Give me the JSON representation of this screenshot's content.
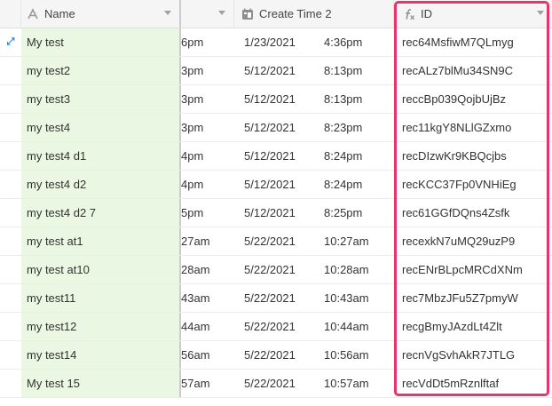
{
  "columns": {
    "name": "Name",
    "time": "Create Time 2",
    "id": "ID"
  },
  "colors": {
    "primary_col_bg": "#eaf8e3",
    "selection": "#e8336d",
    "expand_icon": "#2d7ff9"
  },
  "icons": {
    "name_field": "text-field-icon",
    "time_field": "calendar-field-icon",
    "id_field": "formula-field-icon",
    "row_expand": "expand-arrows-icon"
  },
  "rows": [
    {
      "name": "My test",
      "hidden": "6pm",
      "date": "1/23/2021",
      "time": "4:36pm",
      "id": "rec64MsfiwM7QLmyg"
    },
    {
      "name": "my test2",
      "hidden": "3pm",
      "date": "5/12/2021",
      "time": "8:13pm",
      "id": "recALz7blMu34SN9C"
    },
    {
      "name": "my test3",
      "hidden": "3pm",
      "date": "5/12/2021",
      "time": "8:13pm",
      "id": "reccBp039QojbUjBz"
    },
    {
      "name": "my test4",
      "hidden": "3pm",
      "date": "5/12/2021",
      "time": "8:23pm",
      "id": "rec11kgY8NLlGZxmo"
    },
    {
      "name": "my test4 d1",
      "hidden": "4pm",
      "date": "5/12/2021",
      "time": "8:24pm",
      "id": "recDIzwKr9KBQcjbs"
    },
    {
      "name": "my test4 d2",
      "hidden": "4pm",
      "date": "5/12/2021",
      "time": "8:24pm",
      "id": "recKCC37Fp0VNHiEg"
    },
    {
      "name": "my test4 d2 7",
      "hidden": "5pm",
      "date": "5/12/2021",
      "time": "8:25pm",
      "id": "rec61GGfDQns4Zsfk"
    },
    {
      "name": "my test at1",
      "hidden": "27am",
      "date": "5/22/2021",
      "time": "10:27am",
      "id": "recexkN7uMQ29uzP9"
    },
    {
      "name": "my test at10",
      "hidden": "28am",
      "date": "5/22/2021",
      "time": "10:28am",
      "id": "recENrBLpcMRCdXNm"
    },
    {
      "name": "my test11",
      "hidden": "43am",
      "date": "5/22/2021",
      "time": "10:43am",
      "id": "rec7MbzJFu5Z7pmyW"
    },
    {
      "name": "my test12",
      "hidden": "44am",
      "date": "5/22/2021",
      "time": "10:44am",
      "id": "recgBmyJAzdLt4Zlt"
    },
    {
      "name": "my test14",
      "hidden": "56am",
      "date": "5/22/2021",
      "time": "10:56am",
      "id": "recnVgSvhAkR7JTLG"
    },
    {
      "name": "My test 15",
      "hidden": "57am",
      "date": "5/22/2021",
      "time": "10:57am",
      "id": "recVdDt5mRznlftaf"
    }
  ]
}
